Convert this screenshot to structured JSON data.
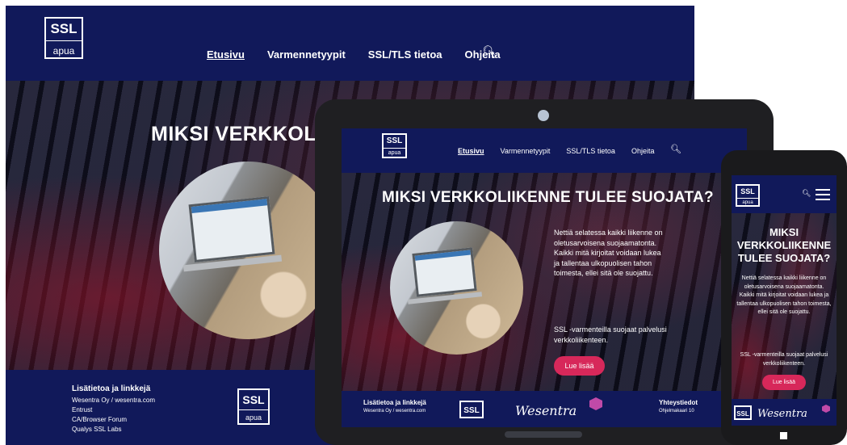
{
  "logo": {
    "line1": "SSL",
    "line2": "apua"
  },
  "nav": {
    "items": [
      "Etusivu",
      "Varmennetyypit",
      "SSL/TLS tietoa",
      "Ohjeita"
    ],
    "search_icon": "search-icon"
  },
  "hero": {
    "title": "MIKSI VERKKOLIIKENNE TULEE SUOJATA?",
    "desktop_title_visible": "MIKSI VERKKOLII",
    "phone_title_lines": [
      "MIKSI",
      "VERKKOLIIKENNE",
      "TULEE SUOJATA?"
    ],
    "paragraph1": "Nettiä selatessa kaikki liikenne on oletusarvoisena suojaamatonta. Kaikki mitä kirjoitat voidaan lukea ja tallentaa ulkopuolisen tahon toimesta, ellei sitä ole suojattu.",
    "paragraph2": "SSL -varmenteilla suojaat palvelusi verkkoliikenteen.",
    "button": "Lue lisää"
  },
  "footer": {
    "links_title": "Lisätietoa ja linkkejä",
    "links": [
      "Wesentra Oy / wesentra.com",
      "Entrust",
      "CA/Browser Forum",
      "Qualys SSL Labs"
    ],
    "partner": "Wesentra",
    "contact_title": "Yhteystiedot",
    "contact_address": "Ohjelmakaari 10"
  },
  "colors": {
    "header_bg": "#11195a",
    "accent_button": "#d7285a",
    "device_frame": "#1f1f22"
  }
}
